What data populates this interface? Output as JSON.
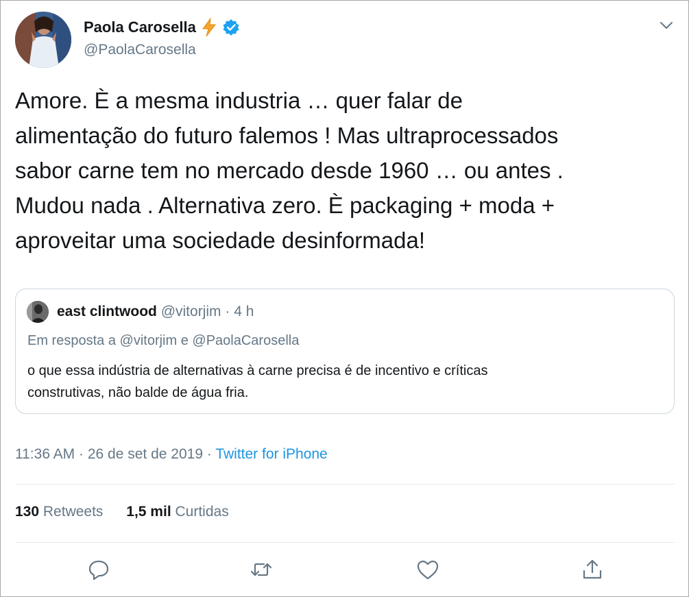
{
  "author": {
    "display_name": "Paola Carosella",
    "handle": "@PaolaCarosella",
    "icons": [
      "lightning-emoji",
      "verified-badge-icon"
    ]
  },
  "tweet": {
    "text": "Amore. È a mesma industria … quer falar de\nalimentação do futuro falemos ! Mas ultraprocessados\nsabor carne tem no mercado desde 1960 … ou antes .\nMudou nada . Alternativa zero. È packaging + moda +\naproveitar uma sociedade desinformada!"
  },
  "quoted_tweet": {
    "display_name": "east clintwood",
    "handle": "@vitorjim",
    "separator": "·",
    "time": "4 h",
    "reply_prefix": "Em resposta a",
    "reply_mention_1": "@vitorjim",
    "reply_conjunction": "e",
    "reply_mention_2": "@PaolaCarosella",
    "text": "o que essa indústria de alternativas à carne precisa é de incentivo e críticas\nconstrutivas, não balde de água fria."
  },
  "meta": {
    "time": "11:36 AM",
    "separator": "·",
    "date": "26 de set de 2019",
    "source": "Twitter for iPhone"
  },
  "stats": {
    "retweets_count": "130",
    "retweets_label": "Retweets",
    "likes_count": "1,5 mil",
    "likes_label": "Curtidas"
  },
  "actions": [
    "reply-icon",
    "retweet-icon",
    "like-icon",
    "share-icon"
  ],
  "colors": {
    "text": "#14171a",
    "secondary": "#657786",
    "link": "#1b95e0",
    "verified": "#1da1f2",
    "border": "#ccd6dd",
    "lightning": "#f4a42a"
  }
}
